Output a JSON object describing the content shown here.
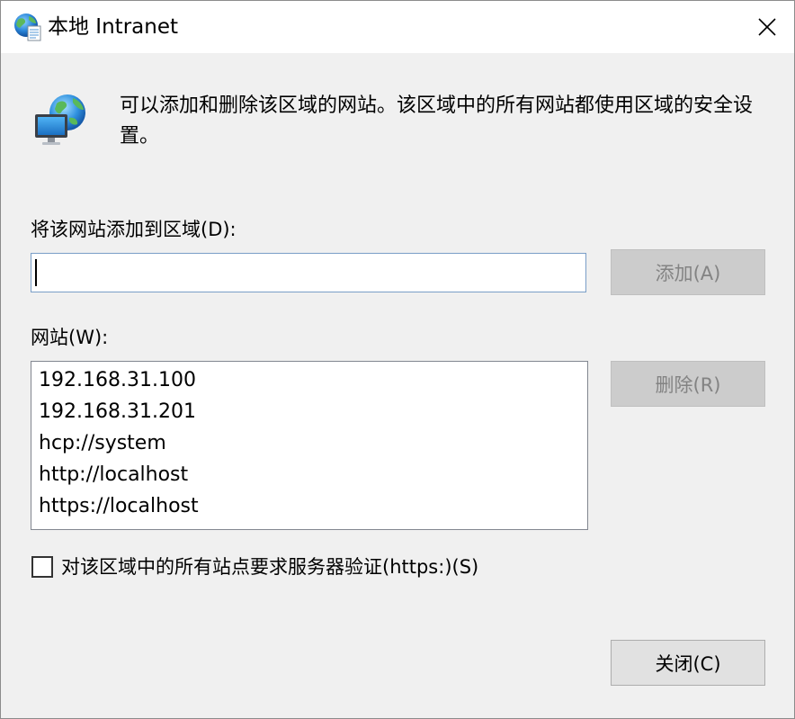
{
  "window": {
    "title": "本地 Intranet",
    "icons": {
      "title_icon": "globe-document-icon",
      "zone_icon": "intranet-monitor-globe-icon",
      "close_icon": "close-icon"
    }
  },
  "description": "可以添加和删除该区域的网站。该区域中的所有网站都使用区域的安全设置。",
  "add_site": {
    "label": "将该网站添加到区域(D):",
    "input_value": "",
    "button_label": "添加(A)"
  },
  "websites": {
    "label": "网站(W):",
    "items": [
      "192.168.31.100",
      "192.168.31.201",
      "hcp://system",
      "http://localhost",
      "https://localhost"
    ],
    "remove_button_label": "删除(R)"
  },
  "require_https": {
    "label": "对该区域中的所有站点要求服务器验证(https:)(S)",
    "checked": false
  },
  "close_button_label": "关闭(C)",
  "colors": {
    "window_bg": "#f0f0f0",
    "titlebar_bg": "#ffffff",
    "input_focus_border": "#7a9ec7",
    "disabled_button_bg": "#cccccc",
    "disabled_text": "#838383"
  }
}
